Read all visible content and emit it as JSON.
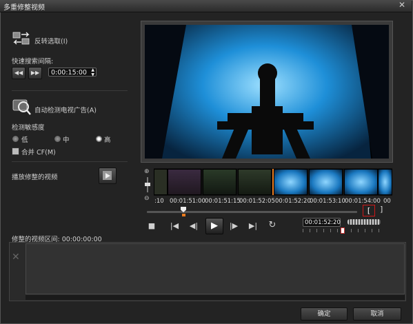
{
  "window": {
    "title": "多重修整视频",
    "close_glyph": "✕"
  },
  "left_panel": {
    "invert_selection_label": "反转选取(I)",
    "fast_search_label": "快速搜索间隔:",
    "rewind_glyph": "◀◀",
    "forward_glyph": "▶▶",
    "interval_value": "0:00:15:00",
    "auto_detect_label": "自动检测电视广告(A)",
    "sensitivity_label": "检测敏感度",
    "sensitivity_options": [
      "低",
      "中",
      "高"
    ],
    "sensitivity_selected": "高",
    "merge_cf_label": "合并 CF(M)",
    "play_trimmed_label": "播放修整的视频",
    "trimmed_interval_label": "修整的视频区间: 00:00:00:00"
  },
  "timeline": {
    "labels": [
      ":10",
      "00:01:51:00",
      "00:01:51:15",
      "00:01:52:05",
      "00:01:52:20",
      "00:01:53:10",
      "00:01:54:00",
      "00"
    ],
    "zoom_in_glyph": "⊕",
    "zoom_out_glyph": "⊖"
  },
  "transport": {
    "stop": "■",
    "prev_key": "|◀",
    "step_back": "◀|",
    "play": "▶",
    "step_fwd": "|▶",
    "next_key": "▶|",
    "loop": "↻",
    "timecode": "00:01:52:20",
    "mark_in": "[",
    "mark_out": "]"
  },
  "clips_panel": {
    "delete_glyph": "✕"
  },
  "buttons": {
    "ok": "确定",
    "cancel": "取消"
  },
  "colors": {
    "accent_orange": "#e87a1e",
    "mark_red": "#d01818",
    "preview_blue": "#1e8fd8"
  }
}
